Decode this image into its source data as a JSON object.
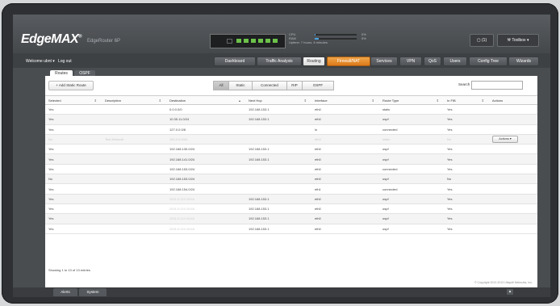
{
  "app": {
    "logo": "EdgeMAX",
    "logo_mark": "®",
    "model": "EdgeRouter 6P"
  },
  "system": {
    "cpu_label": "CPU",
    "cpu_pct": "0%",
    "cpu_value": 0.02,
    "ram_label": "RAM",
    "ram_pct": "5%",
    "ram_value": 0.1,
    "uptime_label": "Uptime:",
    "uptime_value": "7 hours, 6 minutes"
  },
  "header": {
    "alerts_count": "(1)",
    "toolbox_label": "Toolbox"
  },
  "user": {
    "welcome": "Welcome ubnt",
    "logout": "Log out"
  },
  "nav": [
    "Dashboard",
    "Traffic Analysis",
    "Routing",
    "Firewall/NAT",
    "Services",
    "VPN",
    "QoS",
    "Users",
    "Config Tree",
    "Wizards"
  ],
  "nav_active": "Routing",
  "tabs": [
    "Routes",
    "OSPF"
  ],
  "toolbar": {
    "add_label": "+ Add Static Route",
    "filters": [
      "All",
      "Static",
      "Connected",
      "RIP",
      "OSPF"
    ],
    "search_label": "Search"
  },
  "table": {
    "columns": [
      "Selected",
      "Description",
      "Destination",
      "Next Hop",
      "Interface",
      "Route Type",
      "In FIB",
      "Actions"
    ],
    "rows": [
      [
        "Yes",
        "",
        "0.0.0.0/0",
        "192.168.153.1",
        "eth0",
        "static",
        "Yes",
        ""
      ],
      [
        "Yes",
        "",
        "10.35.11.0/24",
        "192.168.153.1",
        "eth0",
        "ospf",
        "Yes",
        ""
      ],
      [
        "Yes",
        "",
        "127.0.0.0/8",
        "",
        "lo",
        "connected",
        "Yes",
        ""
      ],
      [
        "No",
        "Test Network",
        "192.2.0.0/24",
        "",
        "eth3",
        "static",
        "No",
        "Actions"
      ],
      [
        "Yes",
        "",
        "192.168.130.0/24",
        "192.168.153.1",
        "eth0",
        "ospf",
        "Yes",
        ""
      ],
      [
        "Yes",
        "",
        "192.168.141.0/24",
        "192.168.153.1",
        "eth0",
        "ospf",
        "Yes",
        ""
      ],
      [
        "Yes",
        "",
        "192.168.153.0/24",
        "",
        "eth0",
        "connected",
        "Yes",
        ""
      ],
      [
        "No",
        "",
        "192.168.153.0/24",
        "",
        "eth0",
        "ospf",
        "No",
        ""
      ],
      [
        "Yes",
        "",
        "192.168.154.0/24",
        "",
        "eth1",
        "connected",
        "Yes",
        ""
      ],
      [
        "Yes",
        "",
        "2001:0:119:10/48",
        "192.168.153.1",
        "eth0",
        "ospf",
        "Yes",
        ""
      ],
      [
        "Yes",
        "",
        "2001:0:119:10/48",
        "192.168.153.1",
        "eth0",
        "ospf",
        "Yes",
        ""
      ],
      [
        "Yes",
        "",
        "2001:0:119:10/48",
        "192.168.153.1",
        "eth0",
        "ospf",
        "Yes",
        ""
      ],
      [
        "Yes",
        "",
        "2001:0:119:10/48",
        "192.168.153.1",
        "eth0",
        "ospf",
        "Yes",
        ""
      ]
    ],
    "footer": "Showing 1 to 13 of 13 entries"
  },
  "copyright": "© Copyright 2012-2013 Ubiquiti Networks, Inc.",
  "bottom_tabs": [
    "Alerts",
    "System"
  ],
  "colors": {
    "accent_orange": "#e88a2b",
    "port_green": "#6cc24a",
    "bar_blue": "#4aa3df"
  }
}
